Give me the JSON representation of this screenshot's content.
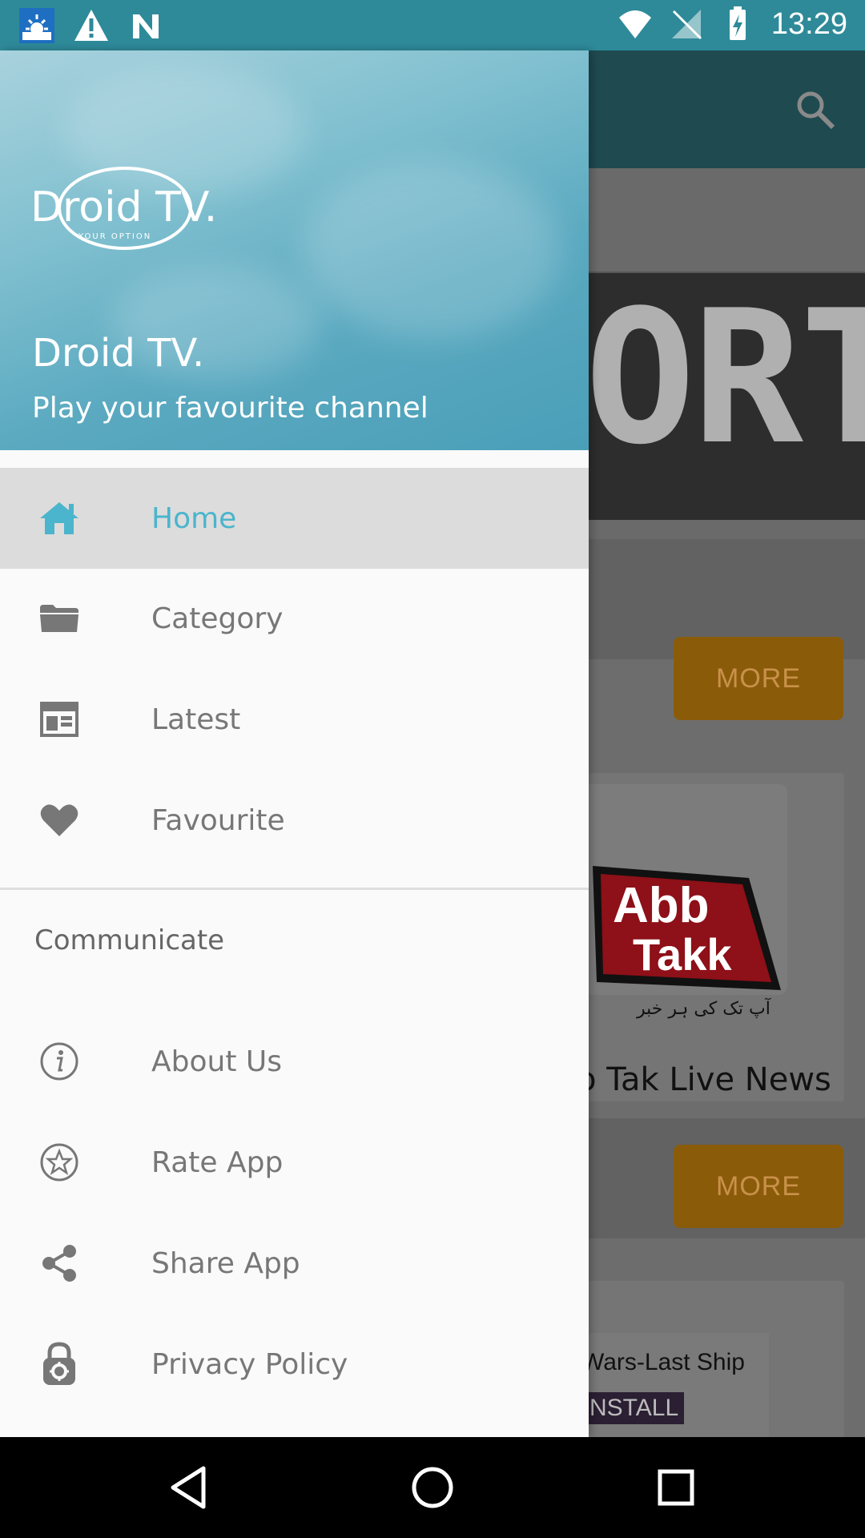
{
  "status_bar": {
    "time": "13:29",
    "left_icons": [
      "weather-icon",
      "warning-icon",
      "n-logo-icon"
    ],
    "right_icons": [
      "wifi-icon",
      "no-signal-icon",
      "battery-charging-icon"
    ]
  },
  "background": {
    "banner_text": "ORTS",
    "more_label_1": "MORE",
    "more_label_2": "MORE",
    "card_logo_line1": "Abb",
    "card_logo_line2": "Takk",
    "card_logo_urdu": "آپ تک کی ہر خبر",
    "card_title": "o Tak Live News",
    "ad_title": "Wars-Last Ship",
    "ad_button": "NSTALL"
  },
  "drawer": {
    "logo_text": "Droid TV.",
    "logo_tagline": "YOUR OPTION",
    "title": "Droid TV.",
    "subtitle": "Play your favourite channel",
    "items": [
      {
        "label": "Home",
        "icon": "home-icon",
        "active": true
      },
      {
        "label": "Category",
        "icon": "folder-icon",
        "active": false
      },
      {
        "label": "Latest",
        "icon": "calendar-icon",
        "active": false
      },
      {
        "label": "Favourite",
        "icon": "heart-icon",
        "active": false
      }
    ],
    "section_title": "Communicate",
    "communicate_items": [
      {
        "label": "About Us",
        "icon": "info-icon"
      },
      {
        "label": "Rate App",
        "icon": "star-icon"
      },
      {
        "label": "Share App",
        "icon": "share-icon"
      },
      {
        "label": "Privacy Policy",
        "icon": "lock-icon"
      }
    ]
  },
  "nav_bar": {
    "buttons": [
      "back-icon",
      "home-circle-icon",
      "recents-icon"
    ]
  },
  "colors": {
    "status_bar": "#2e8a99",
    "accent": "#4ab5cc",
    "active_row": "#dcdcdc",
    "menu_text": "#777777",
    "more_button": "#8a5c0a"
  }
}
